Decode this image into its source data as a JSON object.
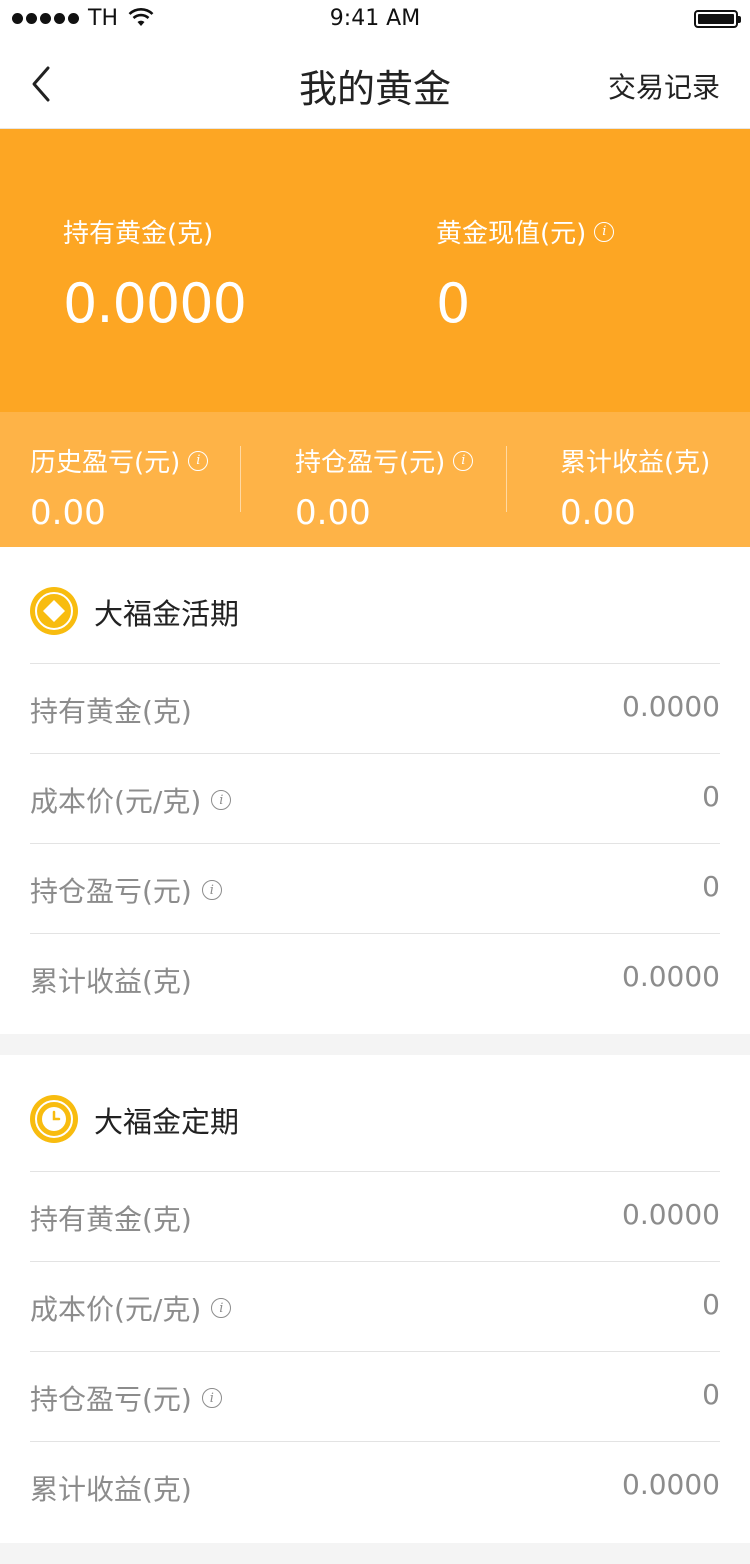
{
  "status_bar": {
    "carrier": "TH",
    "time": "9:41 AM"
  },
  "nav": {
    "title": "我的黄金",
    "right_action": "交易记录"
  },
  "summary": {
    "hold_label": "持有黄金(克)",
    "hold_value": "0.0000",
    "worth_label": "黄金现值(元)",
    "worth_value": "0"
  },
  "stats": [
    {
      "label": "历史盈亏(元)",
      "value": "0.00"
    },
    {
      "label": "持仓盈亏(元)",
      "value": "0.00"
    },
    {
      "label": "累计收益(克)",
      "value": "0.00"
    }
  ],
  "sections": [
    {
      "title": "大福金活期",
      "icon": "diamond-icon",
      "rows": [
        {
          "label": "持有黄金(克)",
          "value": "0.0000"
        },
        {
          "label": "成本价(元/克)",
          "value": "0"
        },
        {
          "label": "持仓盈亏(元)",
          "value": "0"
        },
        {
          "label": "累计收益(克)",
          "value": "0.0000"
        }
      ]
    },
    {
      "title": "大福金定期",
      "icon": "clock-icon",
      "rows": [
        {
          "label": "持有黄金(克)",
          "value": "0.0000"
        },
        {
          "label": "成本价(元/克)",
          "value": "0"
        },
        {
          "label": "持仓盈亏(元)",
          "value": "0"
        },
        {
          "label": "累计收益(克)",
          "value": "0.0000"
        }
      ]
    }
  ],
  "colors": {
    "hero": "#fda623",
    "stats": "#feb347",
    "badge": "#f8bc0f",
    "muted_text": "#8c8c8c"
  }
}
